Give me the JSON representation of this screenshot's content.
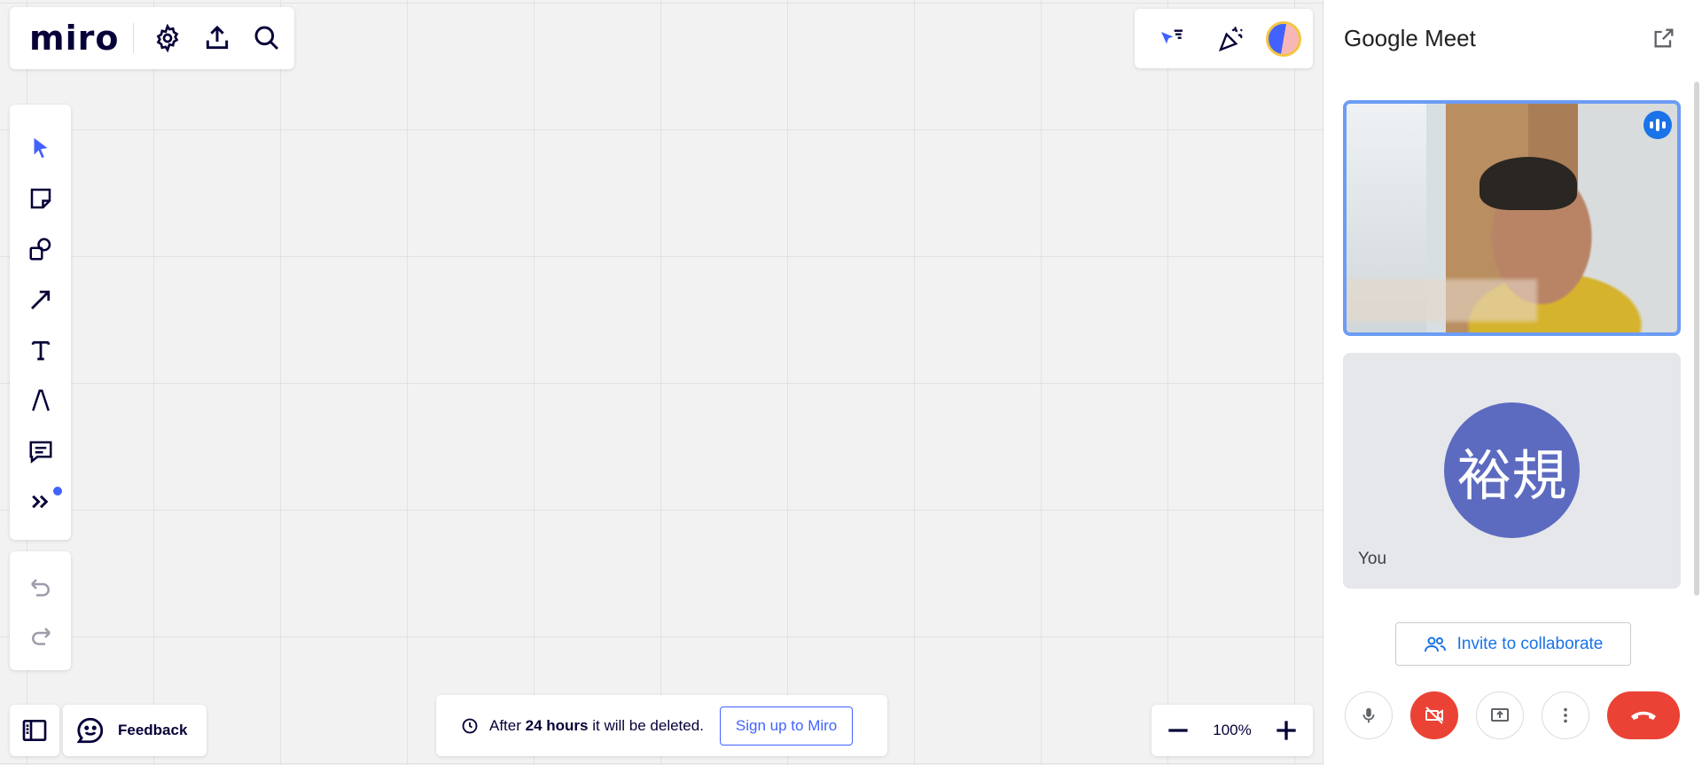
{
  "app": {
    "logo": "miro"
  },
  "topbar": {
    "settings_icon": "gear-icon",
    "export_icon": "upload-icon",
    "search_icon": "search-icon"
  },
  "topright": {
    "icons": [
      "cursor-follow-icon",
      "celebrate-icon",
      "user-avatar"
    ]
  },
  "tools": [
    "select-icon",
    "sticky-note-icon",
    "shapes-icon",
    "arrow-line-icon",
    "text-icon",
    "pen-icon",
    "comment-icon",
    "more-tools-icon"
  ],
  "undo": {
    "undo_icon": "undo-icon",
    "redo_icon": "redo-icon"
  },
  "feedback": {
    "label": "Feedback"
  },
  "notice": {
    "prefix": "After",
    "bold": "24 hours",
    "suffix": "it will be deleted.",
    "signup_label": "Sign up to Miro"
  },
  "zoom": {
    "level": "100%"
  },
  "meet": {
    "title": "Google Meet",
    "you_initials": "裕規",
    "you_label": "You",
    "invite_label": "Invite to collaborate",
    "colors": {
      "hangup": "#ea4335",
      "accent": "#1a73e8",
      "avatar": "#5c6bc0"
    }
  },
  "colors": {
    "miro_accent": "#4262ff"
  }
}
